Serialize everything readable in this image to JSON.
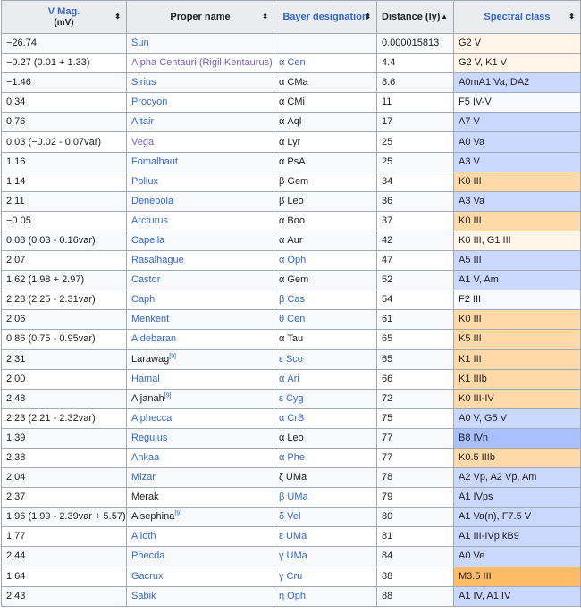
{
  "colors": {
    "header_bg": "#eaecf0",
    "border": "#a2a9b1",
    "link": "#3366cc",
    "visited_link": "#795cb2",
    "spectral": {
      "G": "#fff4e8",
      "K": "#ffd9a8",
      "M": "#ffbb66",
      "F": "#f8f9fe",
      "A": "#cad7ff",
      "B": "#aabfff",
      "A_light": "#d5e0ff"
    }
  },
  "header": {
    "vmag_label": "V Mag.",
    "vmag_sub": "(mV)",
    "proper_name_label": "Proper name",
    "bayer_label": "Bayer designation",
    "distance_label": "Distance (ly)",
    "spectral_label": "Spectral class",
    "sort_icon": "⬍",
    "sort_up_icon": "▲"
  },
  "rows": [
    {
      "vmag": "−26.74",
      "name": "Sun",
      "name_link": "blue",
      "bayer": "",
      "bayer_link": "plain",
      "distance": "0.000015813",
      "spectral": "G2 V",
      "sp_color": "#fff4e8"
    },
    {
      "vmag": "−0.27 (0.01 + 1.33)",
      "name": "Alpha Centauri (Rigil Kentaurus)",
      "name_link": "visited",
      "bayer": "α Cen",
      "bayer_link": "blue",
      "distance": "4.4",
      "spectral": "G2 V, K1 V",
      "sp_color": "#fff4e8"
    },
    {
      "vmag": "−1.46",
      "name": "Sirius",
      "name_link": "blue",
      "bayer": "α CMa",
      "bayer_link": "plain",
      "distance": "8.6",
      "spectral": "A0mA1 Va, DA2",
      "sp_color": "#cad7ff"
    },
    {
      "vmag": "0.34",
      "name": "Procyon",
      "name_link": "blue",
      "bayer": "α CMi",
      "bayer_link": "plain",
      "distance": "11",
      "spectral": "F5 IV-V",
      "sp_color": "#f8f9fe"
    },
    {
      "vmag": "0.76",
      "name": "Altair",
      "name_link": "blue",
      "bayer": "α Aql",
      "bayer_link": "plain",
      "distance": "17",
      "spectral": "A7 V",
      "sp_color": "#cad7ff"
    },
    {
      "vmag": "0.03 (−0.02 - 0.07var)",
      "name": "Vega",
      "name_link": "visited",
      "bayer": "α Lyr",
      "bayer_link": "plain",
      "distance": "25",
      "spectral": "A0 Va",
      "sp_color": "#cad7ff"
    },
    {
      "vmag": "1.16",
      "name": "Fomalhaut",
      "name_link": "blue",
      "bayer": "α PsA",
      "bayer_link": "plain",
      "distance": "25",
      "spectral": "A3 V",
      "sp_color": "#cad7ff"
    },
    {
      "vmag": "1.14",
      "name": "Pollux",
      "name_link": "blue",
      "bayer": "β Gem",
      "bayer_link": "plain",
      "distance": "34",
      "spectral": "K0 III",
      "sp_color": "#ffd9a8"
    },
    {
      "vmag": "2.11",
      "name": "Denebola",
      "name_link": "blue",
      "bayer": "β Leo",
      "bayer_link": "plain",
      "distance": "36",
      "spectral": "A3 Va",
      "sp_color": "#cad7ff"
    },
    {
      "vmag": "−0.05",
      "name": "Arcturus",
      "name_link": "blue",
      "bayer": "α Boo",
      "bayer_link": "plain",
      "distance": "37",
      "spectral": "K0 III",
      "sp_color": "#ffd9a8"
    },
    {
      "vmag": "0.08 (0.03 - 0.16var)",
      "name": "Capella",
      "name_link": "blue",
      "bayer": "α Aur",
      "bayer_link": "plain",
      "distance": "42",
      "spectral": "K0 III, G1 III",
      "sp_color": "#fff4e8"
    },
    {
      "vmag": "2.07",
      "name": "Rasalhague",
      "name_link": "blue",
      "bayer": "α Oph",
      "bayer_link": "blue",
      "distance": "47",
      "spectral": "A5 III",
      "sp_color": "#cad7ff"
    },
    {
      "vmag": "1.62 (1.98 + 2.97)",
      "name": "Castor",
      "name_link": "blue",
      "bayer": "α Gem",
      "bayer_link": "plain",
      "distance": "52",
      "spectral": "A1 V, Am",
      "sp_color": "#cad7ff"
    },
    {
      "vmag": "2.28 (2.25 - 2.31var)",
      "name": "Caph",
      "name_link": "blue",
      "bayer": "β Cas",
      "bayer_link": "blue",
      "distance": "54",
      "spectral": "F2 III",
      "sp_color": "#f8f9fe"
    },
    {
      "vmag": "2.06",
      "name": "Menkent",
      "name_link": "blue",
      "bayer": "θ Cen",
      "bayer_link": "blue",
      "distance": "61",
      "spectral": "K0 III",
      "sp_color": "#ffd9a8"
    },
    {
      "vmag": "0.86 (0.75 - 0.95var)",
      "name": "Aldebaran",
      "name_link": "blue",
      "bayer": "α Tau",
      "bayer_link": "plain",
      "distance": "65",
      "spectral": "K5 III",
      "sp_color": "#ffd9a8"
    },
    {
      "vmag": "2.31",
      "name": "Larawag",
      "name_link": "plain",
      "name_ref": "[9]",
      "bayer": "ε Sco",
      "bayer_link": "blue",
      "distance": "65",
      "spectral": "K1 III",
      "sp_color": "#ffd9a8"
    },
    {
      "vmag": "2.00",
      "name": "Hamal",
      "name_link": "blue",
      "bayer": "α Ari",
      "bayer_link": "blue",
      "distance": "66",
      "spectral": "K1 IIIb",
      "sp_color": "#ffd9a8"
    },
    {
      "vmag": "2.48",
      "name": "Aljanah",
      "name_link": "plain",
      "name_ref": "[9]",
      "bayer": "ε Cyg",
      "bayer_link": "blue",
      "distance": "72",
      "spectral": "K0 III-IV",
      "sp_color": "#ffd9a8"
    },
    {
      "vmag": "2.23 (2.21 - 2.32var)",
      "name": "Alphecca",
      "name_link": "blue",
      "bayer": "α CrB",
      "bayer_link": "blue",
      "distance": "75",
      "spectral": "A0 V, G5 V",
      "sp_color": "#cad7ff"
    },
    {
      "vmag": "1.39",
      "name": "Regulus",
      "name_link": "blue",
      "bayer": "α Leo",
      "bayer_link": "plain",
      "distance": "77",
      "spectral": "B8 IVn",
      "sp_color": "#aabfff"
    },
    {
      "vmag": "2.38",
      "name": "Ankaa",
      "name_link": "blue",
      "bayer": "α Phe",
      "bayer_link": "blue",
      "distance": "77",
      "spectral": "K0.5 IIIb",
      "sp_color": "#ffd9a8"
    },
    {
      "vmag": "2.04",
      "name": "Mizar",
      "name_link": "blue",
      "bayer": "ζ UMa",
      "bayer_link": "plain",
      "distance": "78",
      "spectral": "A2 Vp, A2 Vp, Am",
      "sp_color": "#cad7ff"
    },
    {
      "vmag": "2.37",
      "name": "Merak",
      "name_link": "plain",
      "bayer": "β UMa",
      "bayer_link": "blue",
      "distance": "79",
      "spectral": "A1 IVps",
      "sp_color": "#cad7ff"
    },
    {
      "vmag": "1.96 (1.99 - 2.39var + 5.57)",
      "name": "Alsephina",
      "name_link": "plain",
      "name_ref": "[9]",
      "bayer": "δ Vel",
      "bayer_link": "blue",
      "distance": "80",
      "spectral": "A1 Va(n), F7.5 V",
      "sp_color": "#cad7ff"
    },
    {
      "vmag": "1.77",
      "name": "Alioth",
      "name_link": "blue",
      "bayer": "ε UMa",
      "bayer_link": "blue",
      "distance": "81",
      "spectral": "A1 III-IVp kB9",
      "sp_color": "#cad7ff"
    },
    {
      "vmag": "2.44",
      "name": "Phecda",
      "name_link": "blue",
      "bayer": "γ UMa",
      "bayer_link": "blue",
      "distance": "84",
      "spectral": "A0 Ve",
      "sp_color": "#cad7ff"
    },
    {
      "vmag": "1.64",
      "name": "Gacrux",
      "name_link": "blue",
      "bayer": "γ Cru",
      "bayer_link": "blue",
      "distance": "88",
      "spectral": "M3.5 III",
      "sp_color": "#ffbb66"
    },
    {
      "vmag": "2.43",
      "name": "Sabik",
      "name_link": "blue",
      "bayer": "η Oph",
      "bayer_link": "blue",
      "distance": "88",
      "spectral": "A1 IV, A1 IV",
      "sp_color": "#cad7ff"
    }
  ]
}
